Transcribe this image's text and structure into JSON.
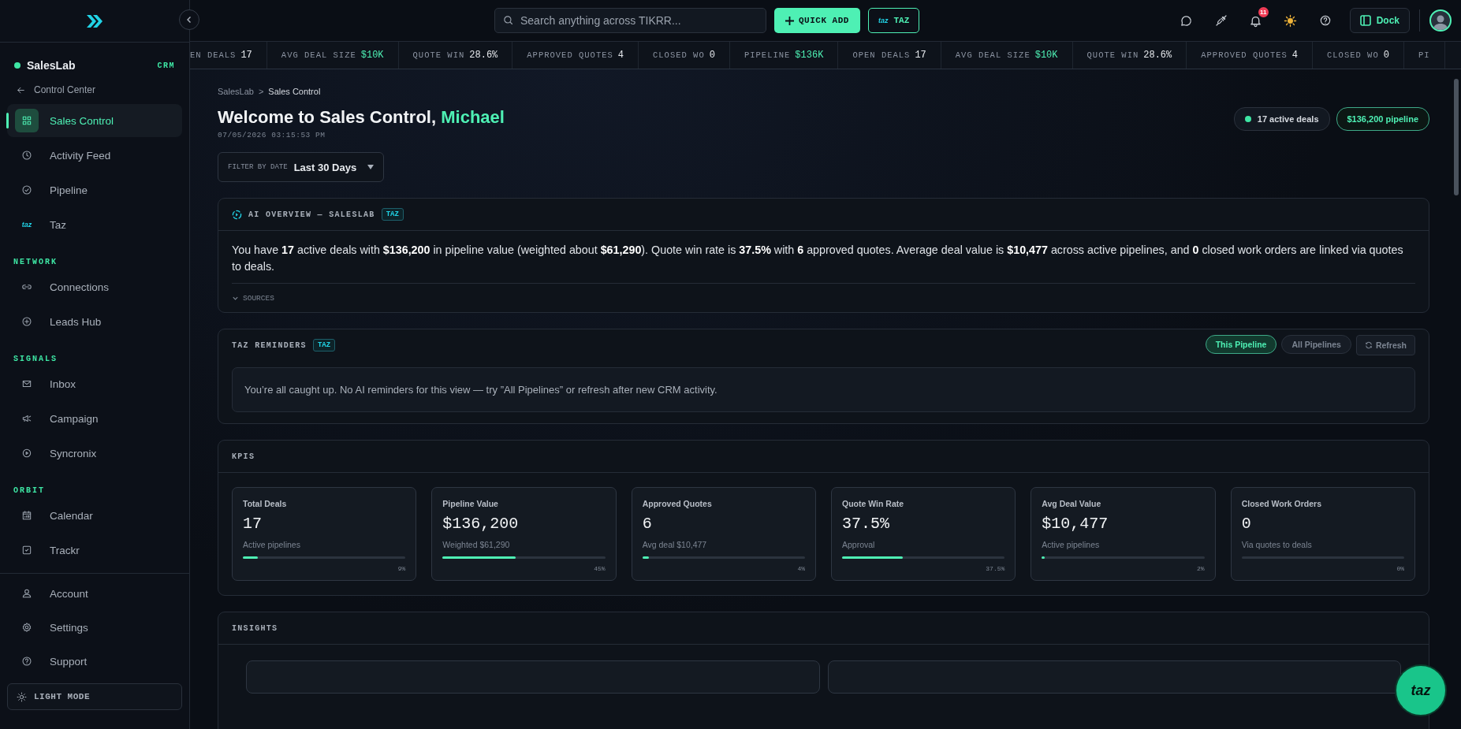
{
  "sidebar": {
    "workspace": {
      "name": "SalesLab",
      "badge": "CRM"
    },
    "back_link": "Control Center",
    "nav_items": [
      {
        "label": "Sales Control",
        "selected": true
      },
      {
        "label": "Activity Feed",
        "selected": false
      },
      {
        "label": "Pipeline",
        "selected": false
      },
      {
        "label": "Taz",
        "selected": false,
        "icon_text": "taz"
      }
    ],
    "sections": [
      {
        "heading": "NETWORK",
        "items": [
          {
            "label": "Connections",
            "selected": false
          },
          {
            "label": "Leads Hub",
            "selected": false
          }
        ]
      },
      {
        "heading": "SIGNALS",
        "items": [
          {
            "label": "Inbox",
            "selected": false
          },
          {
            "label": "Campaign",
            "selected": false
          },
          {
            "label": "Syncronix",
            "selected": false
          }
        ]
      },
      {
        "heading": "ORBIT",
        "items": [
          {
            "label": "Calendar",
            "selected": false
          },
          {
            "label": "Trackr",
            "selected": false
          }
        ]
      }
    ],
    "footer_items": [
      {
        "label": "Account",
        "selected": false
      },
      {
        "label": "Settings",
        "selected": false
      },
      {
        "label": "Support",
        "selected": false
      }
    ],
    "theme_button": "LIGHT MODE"
  },
  "topbar": {
    "search": {
      "placeholder": "Search anything across TIKRR..."
    },
    "quick_add": "QUICK ADD",
    "taz_button": {
      "logo": "taz",
      "label": "TAZ"
    },
    "notifications": {
      "count": "11"
    },
    "dock_button": "Dock"
  },
  "ticker": [
    {
      "label": "EN DEALS",
      "value": "17",
      "accent": false
    },
    {
      "label": "AVG DEAL SIZE",
      "value": "$10K",
      "accent": true
    },
    {
      "label": "QUOTE WIN",
      "value": "28.6%",
      "accent": false
    },
    {
      "label": "APPROVED QUOTES",
      "value": "4",
      "accent": false
    },
    {
      "label": "CLOSED WO",
      "value": "0",
      "accent": false
    },
    {
      "label": "PIPELINE",
      "value": "$136K",
      "accent": true
    },
    {
      "label": "OPEN DEALS",
      "value": "17",
      "accent": false
    },
    {
      "label": "AVG DEAL SIZE",
      "value": "$10K",
      "accent": true
    },
    {
      "label": "QUOTE WIN",
      "value": "28.6%",
      "accent": false
    },
    {
      "label": "APPROVED QUOTES",
      "value": "4",
      "accent": false
    },
    {
      "label": "CLOSED WO",
      "value": "0",
      "accent": false
    },
    {
      "label": "PI"
    }
  ],
  "header": {
    "breadcrumb": {
      "items": [
        "SalesLab",
        "Sales Control"
      ],
      "separator": ">"
    },
    "title": "Welcome to Sales Control, ",
    "name": "Michael",
    "timestamp": "07/05/2026 03:15:53 PM",
    "pills": [
      {
        "label": "17 active deals",
        "kind": "dot"
      },
      {
        "label": "$136,200 pipeline",
        "kind": "accent"
      }
    ],
    "filter": {
      "label": "FILTER BY DATE",
      "value": "Last 30 Days"
    }
  },
  "ai_overview": {
    "title": "AI OVERVIEW — SALESLAB",
    "tag": "TAZ",
    "text": "You have **17** active deals with **$136,200** in pipeline value (weighted about **$61,290**). Quote win rate is **37.5%** with **6** approved quotes. Average deal value is **$10,477** across active pipelines, and **0** closed work orders are linked via quotes to deals.",
    "sources": "SOURCES"
  },
  "reminders": {
    "title": "TAZ REMINDERS",
    "tag": "TAZ",
    "filters": [
      {
        "label": "This Pipeline",
        "selected": true
      },
      {
        "label": "All Pipelines",
        "selected": false
      }
    ],
    "refresh": "Refresh",
    "message": "You’re all caught up. No AI reminders for this view — try ”All Pipelines” or refresh after new CRM activity."
  },
  "kpis": {
    "title": "KPIS",
    "cards": [
      {
        "title": "Total Deals",
        "value": "17",
        "note": "Active pipelines",
        "level": 0.09,
        "reading": "9%"
      },
      {
        "title": "Pipeline Value",
        "value": "$136,200",
        "note": "Weighted $61,290",
        "level": 0.45,
        "reading": "45%"
      },
      {
        "title": "Approved Quotes",
        "value": "6",
        "note": "Avg deal $10,477",
        "level": 0.04,
        "reading": "4%"
      },
      {
        "title": "Quote Win Rate",
        "value": "37.5%",
        "note": "Approval",
        "level": 0.375,
        "reading": "37.5%"
      },
      {
        "title": "Avg Deal Value",
        "value": "$10,477",
        "note": "Active pipelines",
        "level": 0.02,
        "reading": "2%"
      },
      {
        "title": "Closed Work Orders",
        "value": "0",
        "note": "Via quotes to deals",
        "level": 0,
        "reading": "0%"
      }
    ]
  },
  "insights": {
    "title": "INSIGHTS"
  },
  "fab": "taz"
}
